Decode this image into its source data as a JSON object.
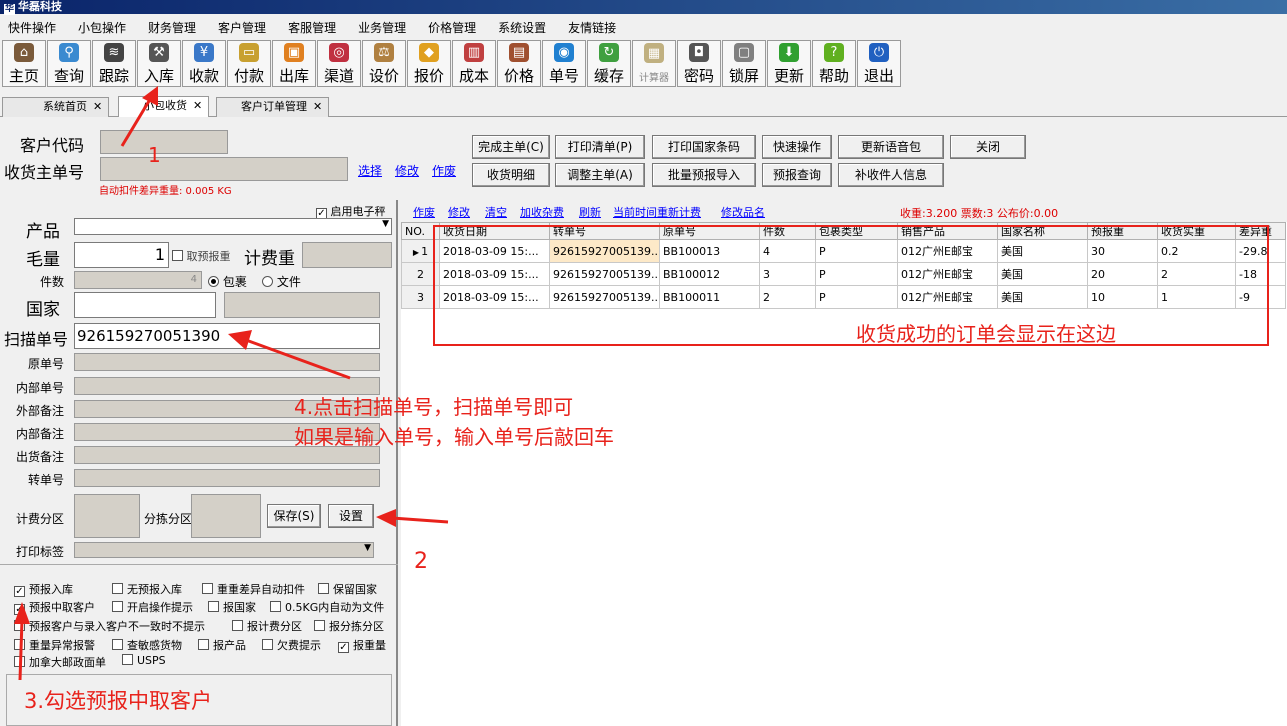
{
  "app": {
    "title": "华磊科技"
  },
  "menu": [
    "快件操作",
    "小包操作",
    "财务管理",
    "客户管理",
    "客服管理",
    "业务管理",
    "价格管理",
    "系统设置",
    "友情链接"
  ],
  "toolbar": [
    {
      "label": "主页",
      "icon": "home-icon",
      "color": "#7a5a3a"
    },
    {
      "label": "查询",
      "icon": "magnifier-icon",
      "color": "#3a8ad0"
    },
    {
      "label": "跟踪",
      "icon": "signal-icon",
      "color": "#444444"
    },
    {
      "label": "入库",
      "icon": "hammer-icon",
      "color": "#555555"
    },
    {
      "label": "收款",
      "icon": "yen-icon",
      "color": "#3a78c8"
    },
    {
      "label": "付款",
      "icon": "money-icon",
      "color": "#c8a030"
    },
    {
      "label": "出库",
      "icon": "box-icon",
      "color": "#e08020"
    },
    {
      "label": "渠道",
      "icon": "ring-icon",
      "color": "#c03040"
    },
    {
      "label": "设价",
      "icon": "scale-icon",
      "color": "#b08040"
    },
    {
      "label": "报价",
      "icon": "bag-icon",
      "color": "#e0a020"
    },
    {
      "label": "成本",
      "icon": "chart-icon",
      "color": "#c04040"
    },
    {
      "label": "价格",
      "icon": "book-icon",
      "color": "#a05030"
    },
    {
      "label": "单号",
      "icon": "eye-icon",
      "color": "#2080d0"
    },
    {
      "label": "缓存",
      "icon": "refresh-icon",
      "color": "#40a040"
    },
    {
      "label": "计算器",
      "icon": "calculator-icon",
      "color": "#c0b080"
    },
    {
      "label": "密码",
      "icon": "safe-icon",
      "color": "#555555"
    },
    {
      "label": "锁屏",
      "icon": "lock-icon",
      "color": "#808080"
    },
    {
      "label": "更新",
      "icon": "down-arrow-icon",
      "color": "#30a030"
    },
    {
      "label": "帮助",
      "icon": "help-icon",
      "color": "#60b020"
    },
    {
      "label": "退出",
      "icon": "power-icon",
      "color": "#2060c0"
    }
  ],
  "tabs": [
    {
      "label": "系统首页"
    },
    {
      "label": "小包收货"
    },
    {
      "label": "客户订单管理"
    }
  ],
  "top": {
    "customer_code_label": "客户代码",
    "master_no_label": "收货主单号",
    "auto_deduct_note": "自动扣件差异重量: 0.005 KG",
    "links": [
      "选择",
      "修改",
      "作废"
    ],
    "buttons_row1": [
      "完成主单(C)",
      "打印清单(P)",
      "打印国家条码",
      "快速操作",
      "更新语音包",
      "关闭"
    ],
    "buttons_row2": [
      "收货明细",
      "调整主单(A)",
      "批量预报导入",
      "预报查询",
      "补收件人信息"
    ]
  },
  "form": {
    "product_label": "产品",
    "gross_label": "毛量",
    "gross_value": "1",
    "take_forecast_weight": "取预报重",
    "billing_weight_label": "计费重",
    "pieces_label": "件数",
    "pieces_value": "4",
    "parcel_label": "包裹",
    "document_label": "文件",
    "country_label": "国家",
    "scan_label": "扫描单号",
    "scan_value": "926159270051390",
    "original_no_label": "原单号",
    "internal_no_label": "内部单号",
    "external_remark_label": "外部备注",
    "internal_remark_label": "内部备注",
    "shipment_remark_label": "出货备注",
    "transfer_no_label": "转单号",
    "billing_zone_label": "计费分区",
    "sort_zone_label": "分拣分区",
    "save_button": "保存(S)",
    "settings_button": "设置",
    "print_label_label": "打印标签"
  },
  "options": [
    {
      "label": "预报入库",
      "checked": true
    },
    {
      "label": "无预报入库",
      "checked": false
    },
    {
      "label": "重重差异自动扣件",
      "checked": false
    },
    {
      "label": "保留国家",
      "checked": false
    },
    {
      "label": "预报中取客户",
      "checked": true
    },
    {
      "label": "开启操作提示",
      "checked": false
    },
    {
      "label": "报国家",
      "checked": false
    },
    {
      "label": "0.5KG内自动为文件",
      "checked": false
    },
    {
      "label": "预报客户与录入客户不一致时不提示",
      "checked": false
    },
    {
      "label": "报计费分区",
      "checked": false
    },
    {
      "label": "报分拣分区",
      "checked": false
    },
    {
      "label": "重量异常报警",
      "checked": false
    },
    {
      "label": "查敏感货物",
      "checked": false
    },
    {
      "label": "报产品",
      "checked": false
    },
    {
      "label": "欠费提示",
      "checked": false
    },
    {
      "label": "报重量",
      "checked": true
    },
    {
      "label": "加拿大邮政面单",
      "checked": false
    },
    {
      "label": "USPS",
      "checked": false
    }
  ],
  "grid_toolbar": {
    "e_label_checkbox": "启用电子秤",
    "links": [
      "作废",
      "修改",
      "清空",
      "加收杂费",
      "刷新",
      "当前时间重新计费",
      "修改品名"
    ],
    "summary": "收重:3.200 票数:3 公布价:0.00"
  },
  "grid": {
    "columns": [
      "NO.",
      "收货日期",
      "转单号",
      "原单号",
      "件数",
      "包裹类型",
      "销售产品",
      "国家名称",
      "预报重",
      "收货实重",
      "差异重"
    ],
    "rows": [
      [
        "1",
        "2018-03-09 15:...",
        "92615927005139...",
        "BB100013",
        "4",
        "P",
        "012广州E邮宝",
        "美国",
        "30",
        "0.2",
        "-29.8"
      ],
      [
        "2",
        "2018-03-09 15:...",
        "92615927005139...",
        "BB100012",
        "3",
        "P",
        "012广州E邮宝",
        "美国",
        "20",
        "2",
        "-18"
      ],
      [
        "3",
        "2018-03-09 15:...",
        "92615927005139...",
        "BB100011",
        "2",
        "P",
        "012广州E邮宝",
        "美国",
        "10",
        "1",
        "-9"
      ]
    ]
  },
  "annotations": {
    "step1": "1",
    "step2": "2",
    "step3": "3.勾选预报中取客户",
    "step4_line1": "4.点击扫描单号，扫描单号即可",
    "step4_line2": "如果是输入单号，输入单号后敲回车",
    "grid_note": "收货成功的订单会显示在这边",
    "color": "#e8221b"
  }
}
